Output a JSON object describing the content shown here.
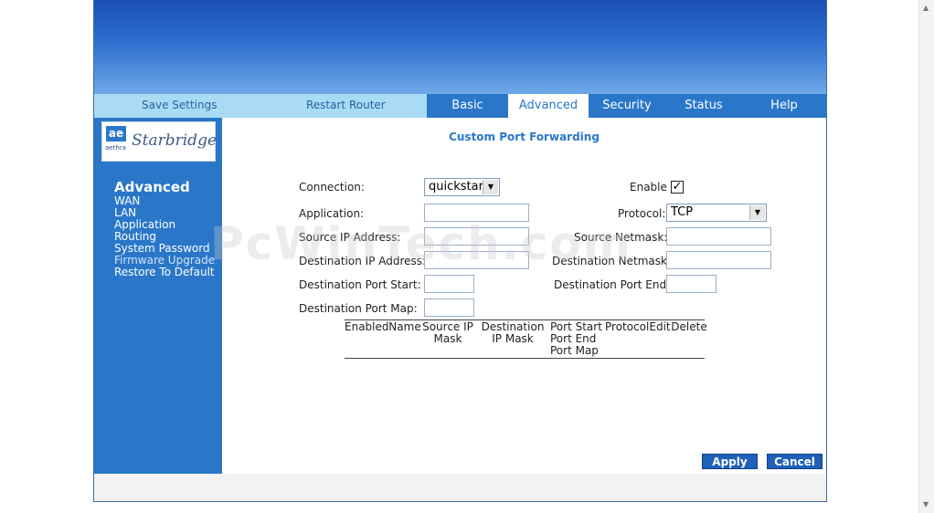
{
  "nav": {
    "save_settings": "Save Settings",
    "restart_router": "Restart Router",
    "tabs": [
      "Basic",
      "Advanced",
      "Security",
      "Status",
      "Help"
    ],
    "active_tab": "Advanced"
  },
  "logo": {
    "mark": "ae",
    "brand_small": "aethra",
    "brand": "Starbridge"
  },
  "sidebar": {
    "heading": "Advanced",
    "items": [
      "WAN",
      "LAN",
      "Application",
      "Routing",
      "System Password",
      "Firmware Upgrade",
      "Restore To Default"
    ]
  },
  "page_title": "Custom Port Forwarding",
  "form": {
    "connection_label": "Connection:",
    "connection_value": "quickstart",
    "enable_label": "Enable",
    "enable_checked": true,
    "application_label": "Application:",
    "protocol_label": "Protocol:",
    "protocol_value": "TCP",
    "source_ip_label": "Source IP Address:",
    "source_netmask_label": "Source Netmask:",
    "dest_ip_label": "Destination IP Address:",
    "dest_netmask_label": "Destination Netmask:",
    "dest_port_start_label": "Destination Port Start:",
    "dest_port_end_label": "Destination Port End:",
    "dest_port_map_label": "Destination Port Map:"
  },
  "table": {
    "headers": [
      "Enabled",
      "Name",
      "Source IP Mask",
      "Destination IP Mask",
      "Port Start Port End Port Map",
      "Protocol",
      "Edit",
      "Delete"
    ]
  },
  "buttons": {
    "apply": "Apply",
    "cancel": "Cancel"
  },
  "watermark": "PcWinTech.com",
  "colors": {
    "accent": "#2a77c9",
    "nav_light": "#a9dcf2",
    "title": "#2a77c9"
  }
}
